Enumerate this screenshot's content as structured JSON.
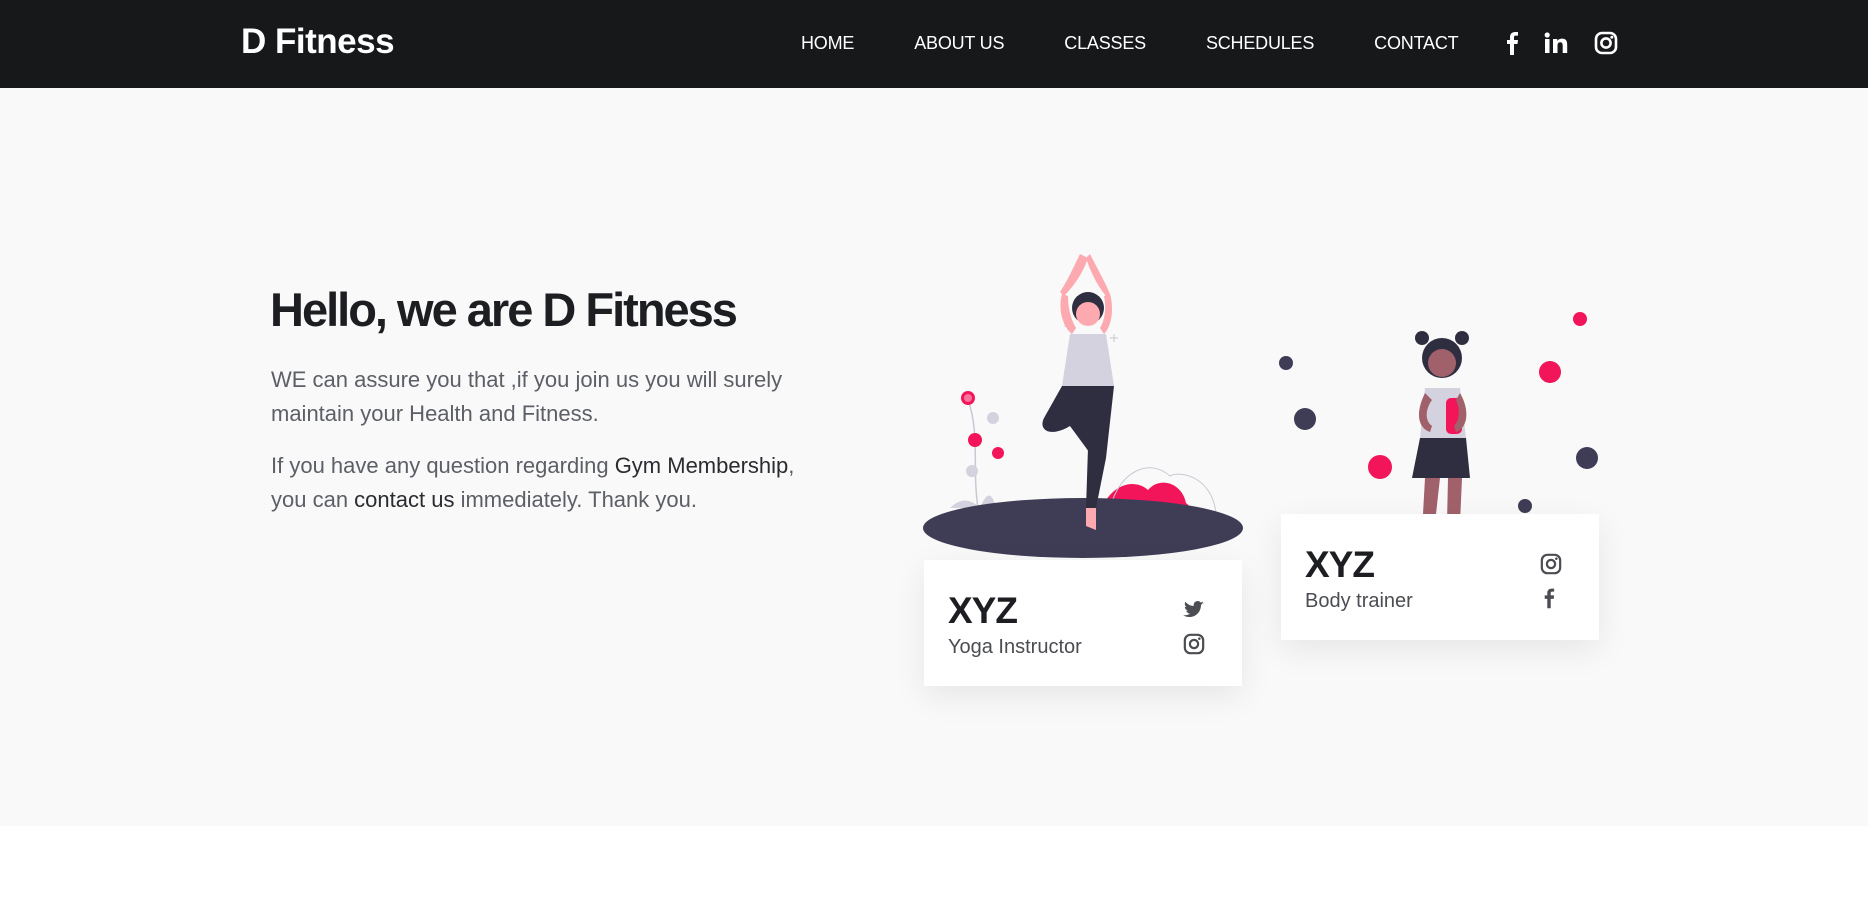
{
  "brand": "D Fitness",
  "nav": {
    "home": "HOME",
    "about": "ABOUT US",
    "classes": "CLASSES",
    "schedules": "SCHEDULES",
    "contact": "CONTACT"
  },
  "social_icons": [
    "facebook-icon",
    "linkedin-icon",
    "instagram-icon"
  ],
  "hero": {
    "title": "Hello, we are D Fitness",
    "p1": "WE can assure you that ,if you join us you will surely maintain your Health and Fitness.",
    "p2_before": "If you have any question regarding ",
    "p2_membership": "Gym Membership",
    "p2_mid": ",\nyou can ",
    "p2_contact": "contact us",
    "p2_after": " immediately. Thank you."
  },
  "trainers": [
    {
      "name": "XYZ",
      "role": "Yoga Instructor",
      "icons": [
        "twitter-icon",
        "instagram-icon"
      ]
    },
    {
      "name": "XYZ",
      "role": "Body trainer",
      "icons": [
        "instagram-icon",
        "facebook-icon"
      ]
    }
  ],
  "colors": {
    "nav_bg": "#17181a",
    "hero_bg": "#f9f9f9",
    "accent": "#f2155a",
    "dark_figure": "#3f3d56"
  }
}
